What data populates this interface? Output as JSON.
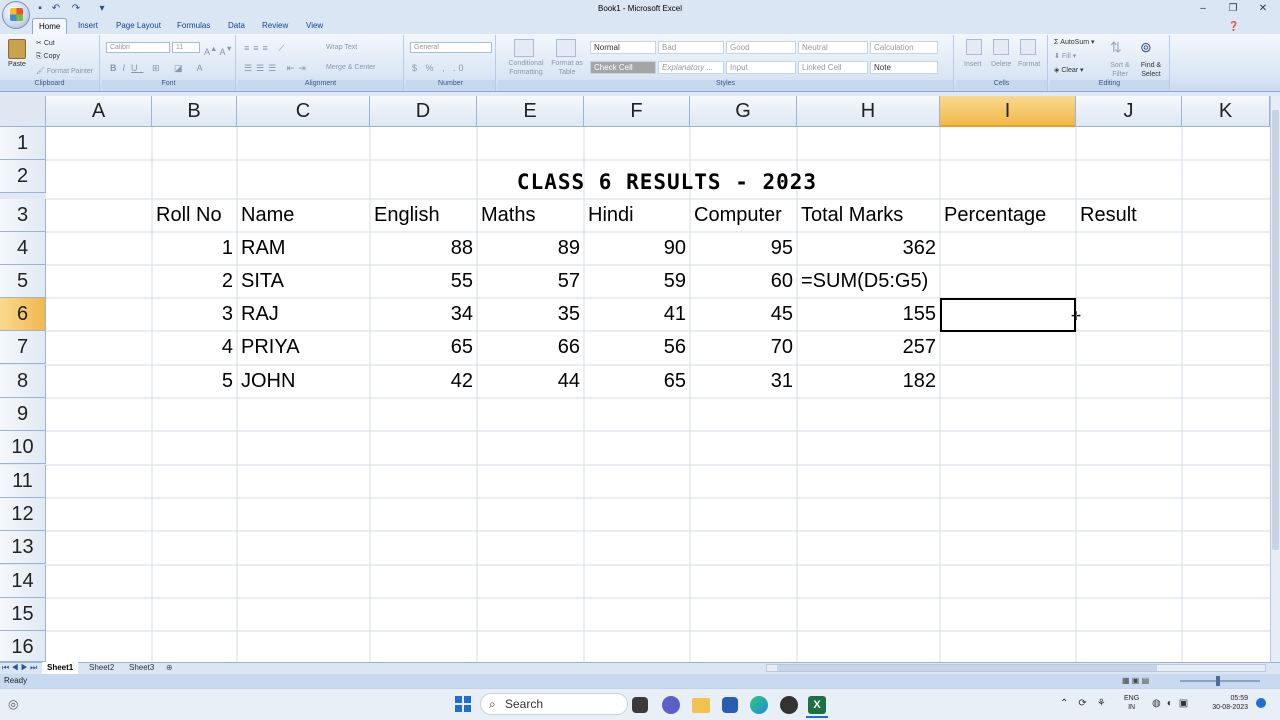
{
  "window": {
    "title": "Book1 - Microsoft Excel"
  },
  "tabs": [
    "Home",
    "Insert",
    "Page Layout",
    "Formulas",
    "Data",
    "Review",
    "View"
  ],
  "ribbon": {
    "clipboard": {
      "paste": "Paste",
      "cut": "Cut",
      "copy": "Copy",
      "format_painter": "Format Painter",
      "label": "Clipboard"
    },
    "font": {
      "name": "Calibri",
      "size": "11",
      "label": "Font"
    },
    "alignment": {
      "wrap": "Wrap Text",
      "merge": "Merge & Center",
      "label": "Alignment"
    },
    "number": {
      "format": "General",
      "label": "Number"
    },
    "styles": {
      "conditional": "Conditional Formatting",
      "format_table": "Format as Table",
      "cells": [
        "Normal",
        "Bad",
        "Good",
        "Neutral",
        "Calculation",
        "Check Cell",
        "Explanatory ...",
        "Input",
        "Linked Cell",
        "Note"
      ],
      "label": "Styles"
    },
    "cells": {
      "insert": "Insert",
      "delete": "Delete",
      "format": "Format",
      "label": "Cells"
    },
    "editing": {
      "autosum": "AutoSum",
      "fill": "Fill",
      "clear": "Clear",
      "sort": "Sort & Filter",
      "find": "Find & Select",
      "label": "Editing"
    }
  },
  "columns": [
    "A",
    "B",
    "C",
    "D",
    "E",
    "F",
    "G",
    "H",
    "I",
    "J",
    "K"
  ],
  "rows": [
    "1",
    "2",
    "3",
    "4",
    "5",
    "6",
    "7",
    "8",
    "9",
    "10",
    "11",
    "12",
    "13",
    "14",
    "15",
    "16"
  ],
  "sheet": {
    "title": "CLASS 6 RESULTS - 2023",
    "headers": [
      "Roll No",
      "Name",
      "English",
      "Maths",
      "Hindi",
      "Computer",
      "Total Marks",
      "Percentage",
      "Result"
    ],
    "data": [
      [
        "1",
        "RAM",
        "88",
        "89",
        "90",
        "95",
        "362"
      ],
      [
        "2",
        "SITA",
        "55",
        "57",
        "59",
        "60",
        "=SUM(D5:G5)"
      ],
      [
        "3",
        "RAJ",
        "34",
        "35",
        "41",
        "45",
        "155"
      ],
      [
        "4",
        "PRIYA",
        "65",
        "66",
        "56",
        "70",
        "257"
      ],
      [
        "5",
        "JOHN",
        "42",
        "44",
        "65",
        "31",
        "182"
      ]
    ]
  },
  "sheet_tabs": [
    "Sheet1",
    "Sheet2",
    "Sheet3"
  ],
  "status": {
    "ready": "Ready"
  },
  "taskbar": {
    "search": "Search",
    "lang1": "ENG",
    "lang2": "IN",
    "time": "05:59",
    "date": "30-08-2023"
  }
}
